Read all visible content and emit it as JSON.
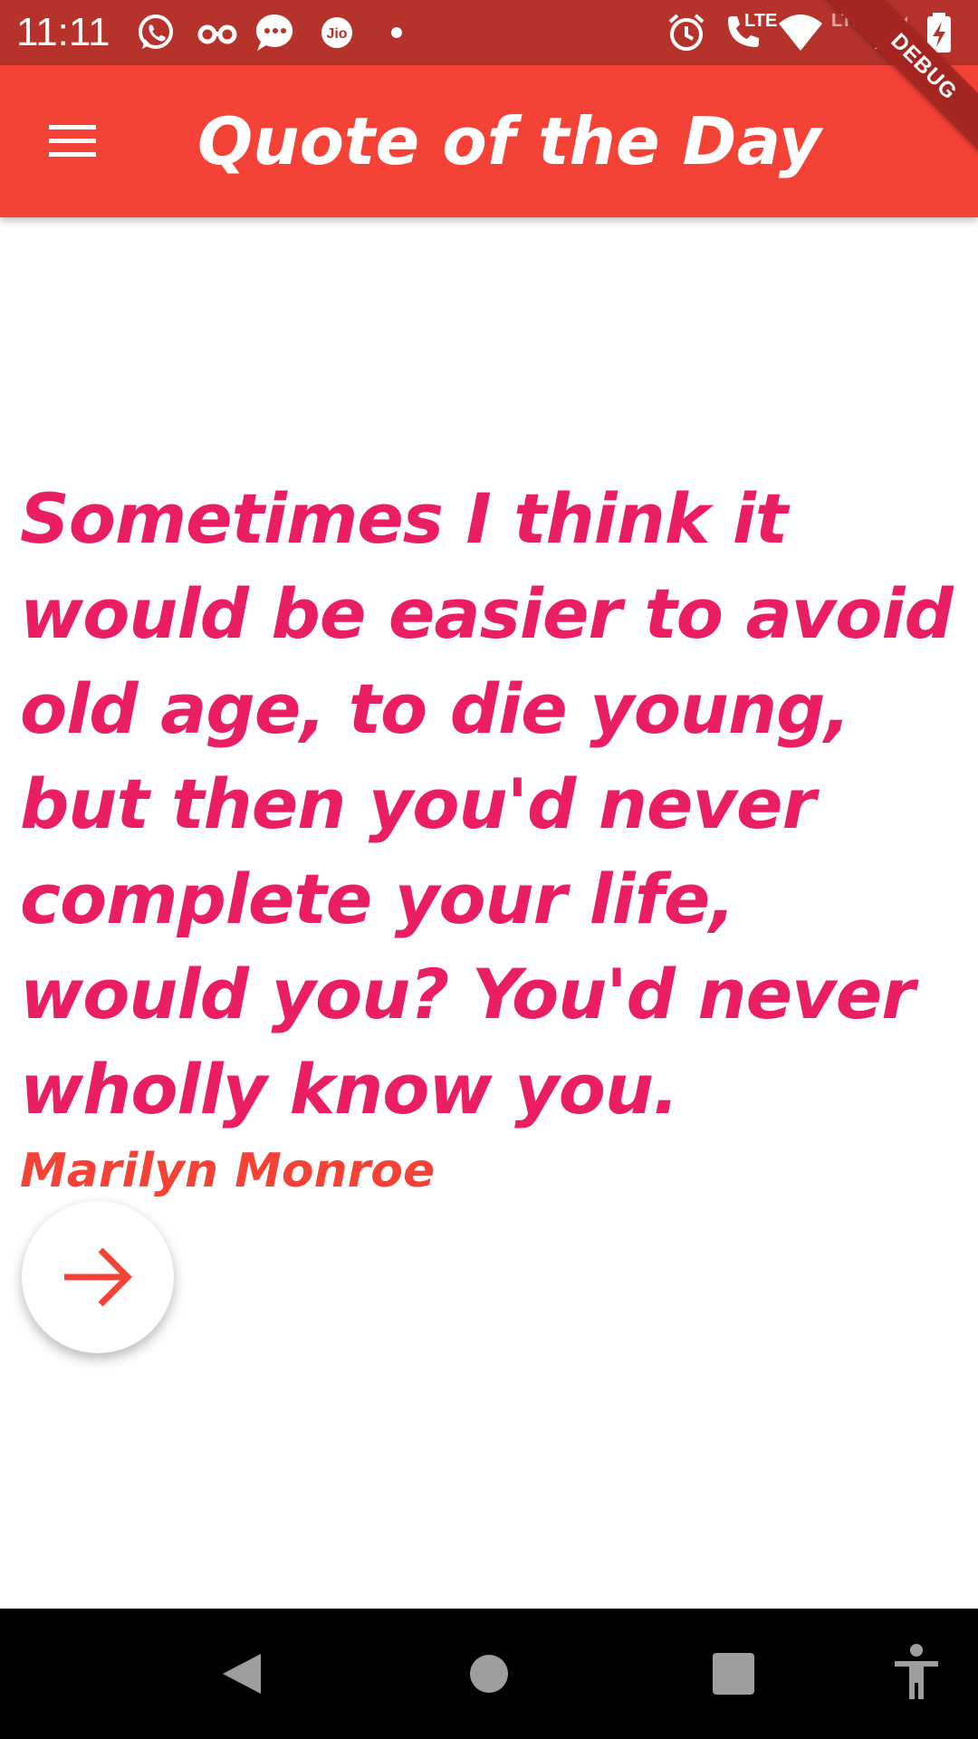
{
  "status_bar": {
    "time": "11:11",
    "lte_label": "LTE",
    "lte_label_2": "LTE",
    "icons": [
      "whatsapp-icon",
      "incognito-icon",
      "messages-icon",
      "jio-icon",
      "dot-icon",
      "alarm-icon",
      "volte-call-icon",
      "wifi-icon",
      "signal-icon",
      "battery-charging-icon"
    ]
  },
  "debug_banner": "DEBUG",
  "app_bar": {
    "title": "Quote of the Day",
    "menu_icon": "menu-icon",
    "background": "#f44336"
  },
  "quote": {
    "text": "Sometimes I think it would be easier to avoid old age, to die young, but then you'd never complete your life, would you? You'd never wholly know you.",
    "author": "Marilyn Monroe",
    "text_color": "#e91e63",
    "author_color": "#f44336"
  },
  "fab": {
    "icon": "arrow-forward-icon"
  },
  "nav_bar": {
    "icons": [
      "back-icon",
      "home-icon",
      "recents-icon",
      "accessibility-icon"
    ]
  }
}
